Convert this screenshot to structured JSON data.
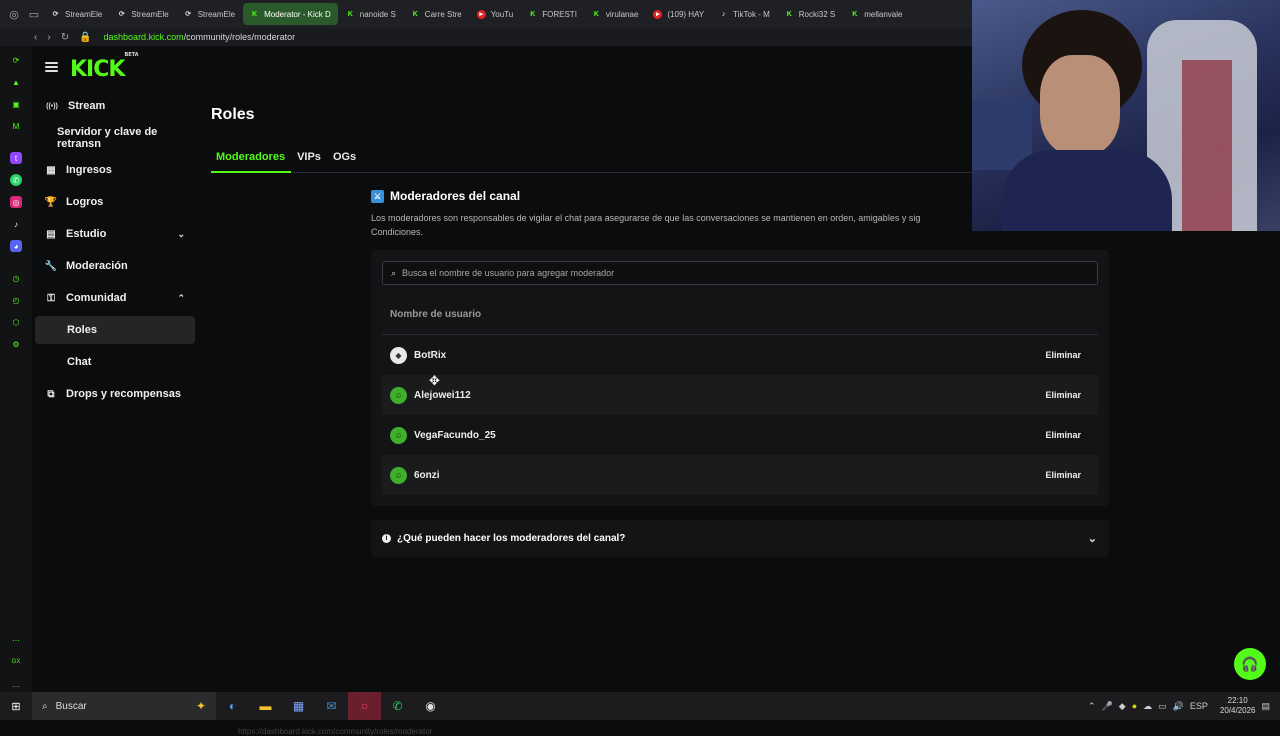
{
  "browser": {
    "tabs": [
      {
        "label": "StreamEle",
        "fav": "s",
        "glyph": "⟳"
      },
      {
        "label": "StreamEle",
        "fav": "s",
        "glyph": "⟳"
      },
      {
        "label": "StreamEle",
        "fav": "s",
        "glyph": "⟳"
      },
      {
        "label": "Moderator - Kick D",
        "fav": "k",
        "glyph": "K",
        "active": true
      },
      {
        "label": "nanoide S",
        "fav": "k",
        "glyph": "K"
      },
      {
        "label": "Carre Stre",
        "fav": "k",
        "glyph": "K"
      },
      {
        "label": "YouTu",
        "fav": "y",
        "glyph": "▸"
      },
      {
        "label": "FORESTI",
        "fav": "k",
        "glyph": "K"
      },
      {
        "label": "virulanae",
        "fav": "k",
        "glyph": "K"
      },
      {
        "label": "(109) HAY",
        "fav": "y",
        "glyph": "▸"
      },
      {
        "label": "TikTok - M",
        "fav": "t",
        "glyph": "♪"
      },
      {
        "label": "Rocki32 S",
        "fav": "k",
        "glyph": "K"
      },
      {
        "label": "mellanvale",
        "fav": "k",
        "glyph": "K"
      }
    ],
    "url_host": "dashboard.kick.com",
    "url_path": "/community/roles/moderator",
    "status_url": "https://dashboard.kick.com/community/roles/moderator"
  },
  "sidebar": {
    "logo": "KICK",
    "logo_tag": "BETA",
    "items": [
      {
        "label": "Stream",
        "icon": "broadcast-icon",
        "glyph": "((•))"
      },
      {
        "label": "Servidor y clave de retransn",
        "sub": true
      },
      {
        "label": "Ingresos",
        "icon": "bars-icon",
        "glyph": "▦"
      },
      {
        "label": "Logros",
        "icon": "trophy-icon",
        "glyph": "🏆"
      },
      {
        "label": "Estudio",
        "icon": "grid-icon",
        "glyph": "▤",
        "chev": "⌄"
      },
      {
        "label": "Moderación",
        "icon": "wrench-icon",
        "glyph": "🔧"
      },
      {
        "label": "Comunidad",
        "icon": "community-icon",
        "glyph": "⚿",
        "chev": "⌃"
      },
      {
        "label": "Roles",
        "sub": true,
        "active": true
      },
      {
        "label": "Chat",
        "sub": true
      },
      {
        "label": "Drops y recompensas",
        "icon": "gift-icon",
        "glyph": "⧉"
      }
    ]
  },
  "main": {
    "title": "Roles",
    "tabs": [
      "Moderadores",
      "VIPs",
      "OGs"
    ],
    "section_title": "Moderadores del canal",
    "section_desc_1": "Los moderadores son responsables de vigilar el chat para asegurarse de que las conversaciones se mantienen en orden, amigables y sig",
    "section_desc_2": "Condiciones.",
    "search_placeholder": "Busca el nombre de usuario para agregar moderador",
    "column_header": "Nombre de usuario",
    "remove_label": "Eliminar",
    "moderators": [
      {
        "name": "BotRix",
        "avatar_color": "#e8e8e8"
      },
      {
        "name": "Alejowei112",
        "avatar_color": "#3fae2a"
      },
      {
        "name": "VegaFacundo_25",
        "avatar_color": "#3fae2a"
      },
      {
        "name": "6onzi",
        "avatar_color": "#3fae2a"
      }
    ],
    "faq_label": "¿Qué pueden hacer los moderadores del canal?"
  },
  "taskbar": {
    "search_label": "Buscar",
    "lang": "ESP",
    "time": "22:10",
    "date": "20/4/2026"
  }
}
